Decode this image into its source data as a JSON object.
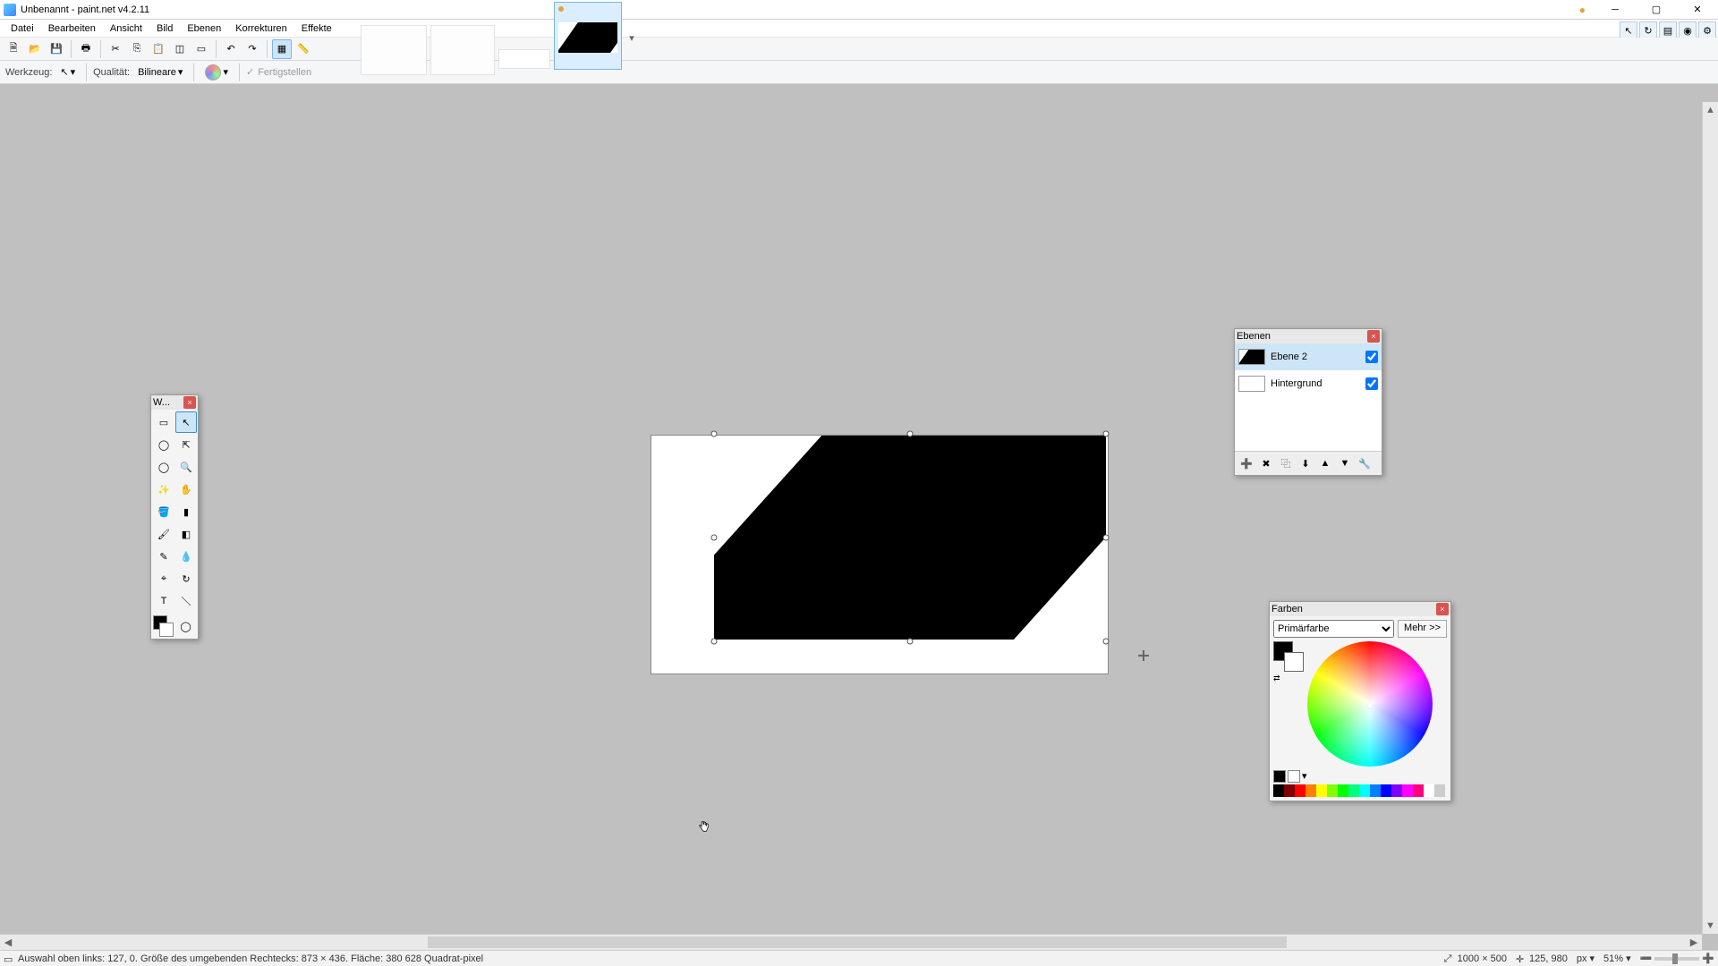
{
  "window": {
    "title": "Unbenannt - paint.net v4.2.11"
  },
  "menubar": [
    "Datei",
    "Bearbeiten",
    "Ansicht",
    "Bild",
    "Ebenen",
    "Korrekturen",
    "Effekte"
  ],
  "tooloptions": {
    "tool_label": "Werkzeug:",
    "quality_label": "Qualität:",
    "quality_value": "Bilineare",
    "finish_label": "Fertigstellen"
  },
  "tools_panel": {
    "title": "W..."
  },
  "layers_panel": {
    "title": "Ebenen",
    "layers": [
      {
        "name": "Ebene 2",
        "visible": true,
        "selected": true,
        "has_shape": true
      },
      {
        "name": "Hintergrund",
        "visible": true,
        "selected": false,
        "has_shape": false
      }
    ]
  },
  "colors_panel": {
    "title": "Farben",
    "mode": "Primärfarbe",
    "more": "Mehr >>"
  },
  "status": {
    "selection_text": "Auswahl oben links: 127, 0. Größe des umgebenden Rechtecks: 873 × 436. Fläche: 380 628 Quadrat-pixel",
    "image_size": "1000 × 500",
    "cursor_pos": "125, 980",
    "unit": "px",
    "zoom": "51%"
  },
  "palette_colors": [
    "#000",
    "#7f0000",
    "#ff0000",
    "#ff7f00",
    "#ffff00",
    "#7fff00",
    "#00ff00",
    "#00ff7f",
    "#00ffff",
    "#007fff",
    "#0000ff",
    "#7f00ff",
    "#ff00ff",
    "#ff007f",
    "#fff",
    "#ccc"
  ]
}
